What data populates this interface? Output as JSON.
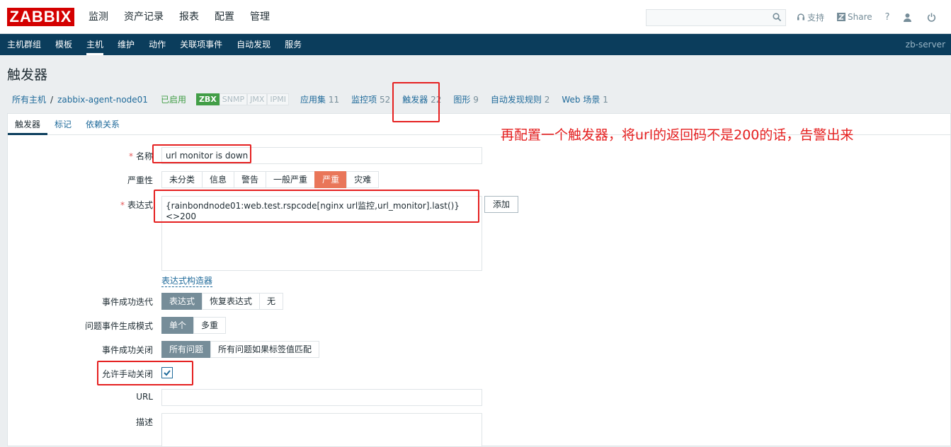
{
  "header": {
    "logo": "ZABBIX",
    "menu": [
      "监测",
      "资产记录",
      "报表",
      "配置",
      "管理"
    ],
    "active_menu": 3,
    "search_placeholder": "",
    "support": "支持",
    "share": "Share",
    "help": "?"
  },
  "submenu": {
    "items": [
      "主机群组",
      "模板",
      "主机",
      "维护",
      "动作",
      "关联项事件",
      "自动发现",
      "服务"
    ],
    "active": 2,
    "server": "zb-server"
  },
  "page_title": "触发器",
  "breadcrumb": {
    "all_hosts": "所有主机",
    "separator": "/",
    "host": "zabbix-agent-node01",
    "status": "已启用",
    "tags": [
      "ZBX",
      "SNMP",
      "JMX",
      "IPMI"
    ],
    "nav": [
      {
        "label": "应用集",
        "count": "11"
      },
      {
        "label": "监控项",
        "count": "52"
      },
      {
        "label": "触发器",
        "count": "22"
      },
      {
        "label": "图形",
        "count": "9"
      },
      {
        "label": "自动发现规则",
        "count": "2"
      },
      {
        "label": "Web 场景",
        "count": "1"
      }
    ]
  },
  "tabs": [
    "触发器",
    "标记",
    "依赖关系"
  ],
  "form": {
    "name_label": "名称",
    "name_value": "url monitor is down",
    "severity_label": "严重性",
    "severity_options": [
      "未分类",
      "信息",
      "警告",
      "一般严重",
      "严重",
      "灾难"
    ],
    "severity_selected": 4,
    "expression_label": "表达式",
    "expression_value": "{rainbondnode01:web.test.rspcode[nginx url监控,url_monitor].last()}<>200",
    "add_button": "添加",
    "expression_builder": "表达式构造器",
    "ok_event_label": "事件成功迭代",
    "ok_event_options": [
      "表达式",
      "恢复表达式",
      "无"
    ],
    "problem_mode_label": "问题事件生成模式",
    "problem_mode_options": [
      "单个",
      "多重"
    ],
    "ok_close_label": "事件成功关闭",
    "ok_close_options": [
      "所有问题",
      "所有问题如果标签值匹配"
    ],
    "manual_close_label": "允许手动关闭",
    "manual_close_checked": true,
    "url_label": "URL",
    "url_value": "",
    "description_label": "描述",
    "description_value": ""
  },
  "annotation_note": "再配置一个触发器，将url的返回码不是200的话，告警出来",
  "colors": {
    "brand": "#d40000",
    "nav_bg": "#0b3d5c",
    "annotation": "#e52020",
    "severity_high": "#e97659"
  }
}
